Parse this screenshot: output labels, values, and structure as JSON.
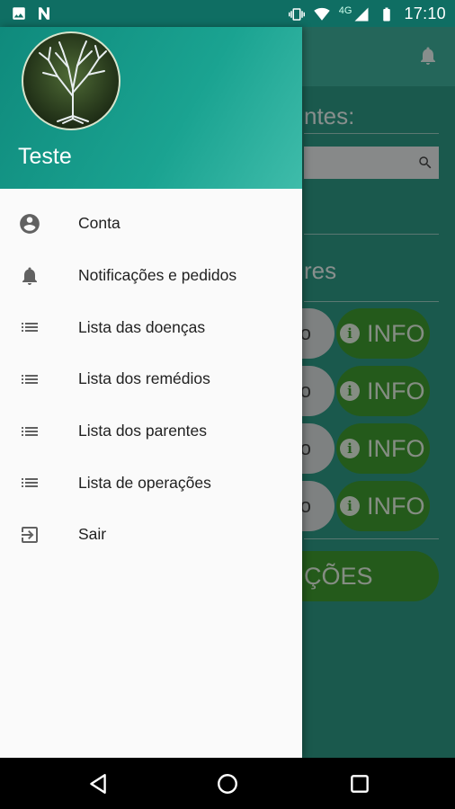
{
  "status_bar": {
    "time": "17:10",
    "network": "4G",
    "left_icons": [
      "image-icon",
      "n-notification-icon"
    ],
    "right_icons": [
      "vibrate-icon",
      "wifi-icon",
      "signal-icon",
      "battery-icon"
    ]
  },
  "background_screen": {
    "section_title_partial": "ntes:",
    "section2_title_partial": "res",
    "rows": [
      {
        "left_partial": "o",
        "info_label": "INFO"
      },
      {
        "left_partial": "o",
        "info_label": "INFO"
      },
      {
        "left_partial": "o",
        "info_label": "INFO"
      },
      {
        "left_partial": "o",
        "info_label": "INFO"
      }
    ],
    "big_button_partial": "ÇÕES"
  },
  "drawer": {
    "user_name": "Teste",
    "items": [
      {
        "label": "Conta",
        "icon": "account-circle-icon"
      },
      {
        "label": "Notificações e pedidos",
        "icon": "bell-icon"
      },
      {
        "label": "Lista das doenças",
        "icon": "list-icon"
      },
      {
        "label": "Lista dos remédios",
        "icon": "list-icon"
      },
      {
        "label": "Lista dos parentes",
        "icon": "list-icon"
      },
      {
        "label": "Lista de operações",
        "icon": "list-icon"
      },
      {
        "label": "Sair",
        "icon": "exit-icon"
      }
    ]
  },
  "nav_bar": {
    "buttons": [
      "back-icon",
      "home-icon",
      "recents-icon"
    ]
  },
  "colors": {
    "header_teal": "#1aa391",
    "info_green": "#3e9b30",
    "drawer_bg": "#fafafa"
  }
}
